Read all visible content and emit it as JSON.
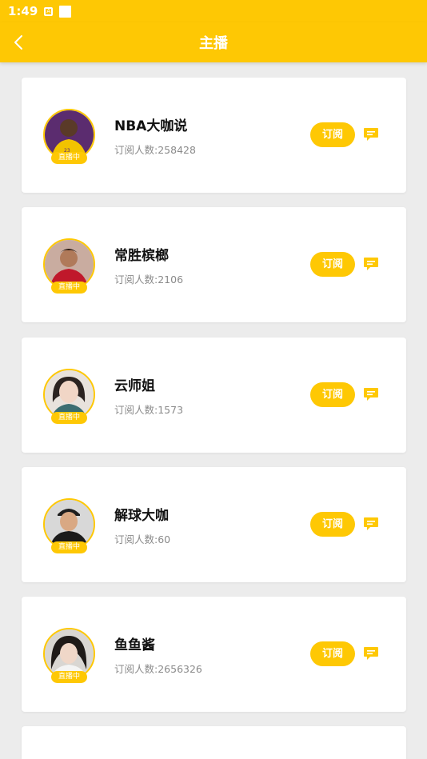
{
  "status_bar": {
    "time": "1:49",
    "notice_icon": "a-notification-icon"
  },
  "header": {
    "title": "主播",
    "back_icon": "chevron-left-icon"
  },
  "colors": {
    "accent": "#fec804",
    "background": "#ececec",
    "card": "#ffffff"
  },
  "anchors": [
    {
      "name": "NBA大咖说",
      "subscribers": "订阅人数:258428",
      "live_label": "直播中",
      "subscribe_label": "订阅",
      "chat_icon": "chat-bubble-icon"
    },
    {
      "name": "常胜槟榔",
      "subscribers": "订阅人数:2106",
      "live_label": "直播中",
      "subscribe_label": "订阅",
      "chat_icon": "chat-bubble-icon"
    },
    {
      "name": "云师姐",
      "subscribers": "订阅人数:1573",
      "live_label": "直播中",
      "subscribe_label": "订阅",
      "chat_icon": "chat-bubble-icon"
    },
    {
      "name": "解球大咖",
      "subscribers": "订阅人数:60",
      "live_label": "直播中",
      "subscribe_label": "订阅",
      "chat_icon": "chat-bubble-icon"
    },
    {
      "name": "鱼鱼酱",
      "subscribers": "订阅人数:2656326",
      "live_label": "直播中",
      "subscribe_label": "订阅",
      "chat_icon": "chat-bubble-icon"
    }
  ]
}
